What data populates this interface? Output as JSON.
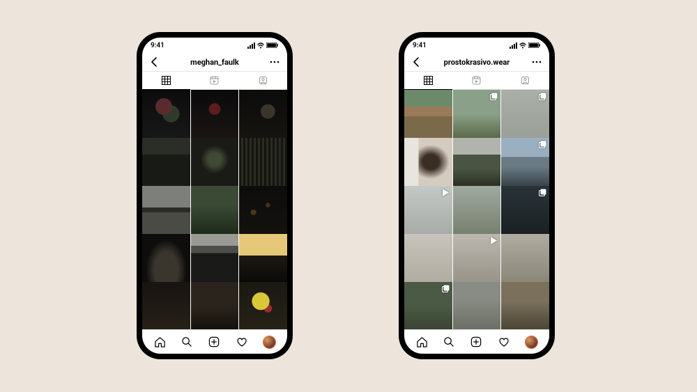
{
  "status": {
    "time": "9:41"
  },
  "phones": [
    {
      "username": "meghan_faulk",
      "cells": [
        {
          "cls": "p-a1",
          "badge": null
        },
        {
          "cls": "p-a2",
          "badge": null
        },
        {
          "cls": "p-a3",
          "badge": null
        },
        {
          "cls": "p-a4",
          "badge": null
        },
        {
          "cls": "p-a5",
          "badge": null
        },
        {
          "cls": "p-a6",
          "badge": null
        },
        {
          "cls": "p-a7",
          "badge": null
        },
        {
          "cls": "p-a8",
          "badge": null
        },
        {
          "cls": "p-a9",
          "badge": null
        },
        {
          "cls": "p-a10",
          "badge": null
        },
        {
          "cls": "p-a11",
          "badge": null
        },
        {
          "cls": "p-a12",
          "badge": null
        },
        {
          "cls": "p-a13",
          "badge": null
        },
        {
          "cls": "p-a14",
          "badge": null
        },
        {
          "cls": "p-a15",
          "badge": null
        }
      ]
    },
    {
      "username": "prostokrasivo.wear",
      "cells": [
        {
          "cls": "p-b1",
          "badge": null
        },
        {
          "cls": "p-b2",
          "badge": "multi"
        },
        {
          "cls": "p-b3",
          "badge": "multi"
        },
        {
          "cls": "p-b4",
          "badge": null
        },
        {
          "cls": "p-b5",
          "badge": null
        },
        {
          "cls": "p-b6",
          "badge": "multi"
        },
        {
          "cls": "p-b7",
          "badge": "video"
        },
        {
          "cls": "p-b8",
          "badge": null
        },
        {
          "cls": "p-b9",
          "badge": "multi"
        },
        {
          "cls": "p-b10",
          "badge": null
        },
        {
          "cls": "p-b11",
          "badge": "video"
        },
        {
          "cls": "p-b12",
          "badge": null
        },
        {
          "cls": "p-b13",
          "badge": "multi"
        },
        {
          "cls": "p-b14",
          "badge": null
        },
        {
          "cls": "p-b15",
          "badge": null
        }
      ]
    }
  ]
}
